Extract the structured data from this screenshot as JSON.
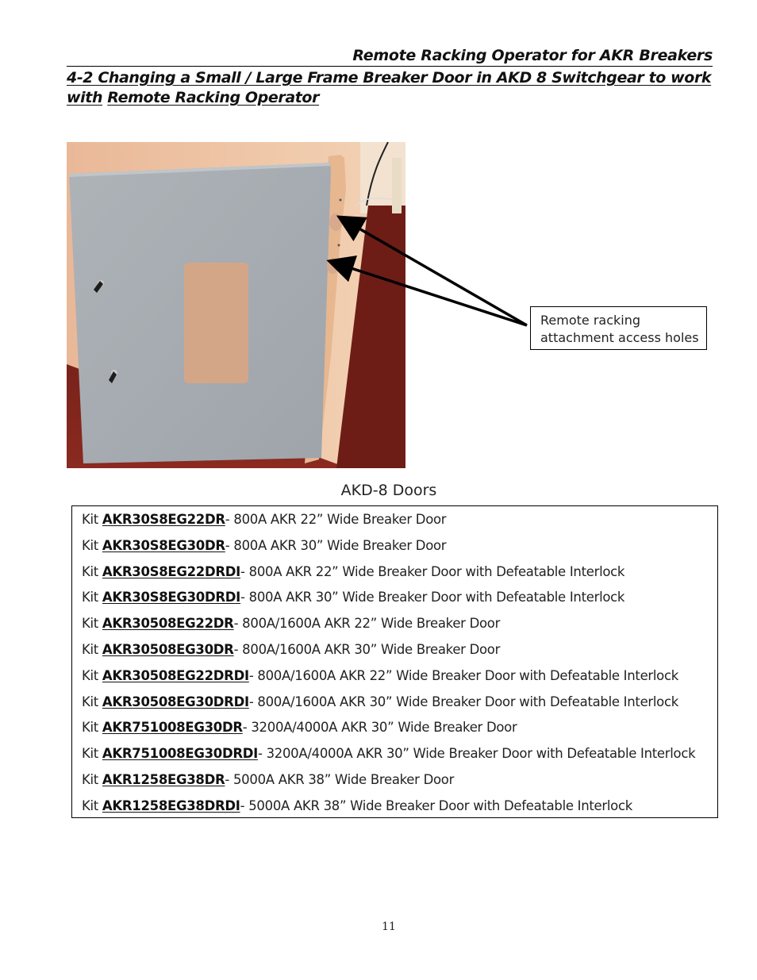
{
  "header": {
    "running_title": "Remote Racking Operator for AKR Breakers"
  },
  "section": {
    "title_line1": "4-2 Changing a Small / Large Frame Breaker Door in AKD 8 Switchgear to work with",
    "title_line2": "Remote Racking Operator"
  },
  "figure": {
    "description": "Photo of grey AKD-8 breaker door with viewing window and two access holes",
    "callout_line1": "Remote racking",
    "callout_line2": "attachment access holes",
    "colors": {
      "door": "#a7acb1",
      "wall": "#f0c9a4",
      "floor": "#7a1f18",
      "window": "#d6a98a"
    }
  },
  "kits": {
    "caption": "AKD-8 Doors",
    "prefix": "Kit ",
    "items": [
      {
        "code": "AKR30S8EG22DR",
        "desc": "- 800A AKR 22” Wide Breaker Door"
      },
      {
        "code": "AKR30S8EG30DR",
        "desc": "- 800A AKR 30” Wide Breaker Door"
      },
      {
        "code": "AKR30S8EG22DRDI",
        "desc": "- 800A AKR 22” Wide Breaker Door with Defeatable Interlock"
      },
      {
        "code": "AKR30S8EG30DRDI",
        "desc": "- 800A AKR 30” Wide Breaker Door with Defeatable Interlock"
      },
      {
        "code": "AKR30508EG22DR",
        "desc": "- 800A/1600A AKR 22” Wide Breaker Door"
      },
      {
        "code": "AKR30508EG30DR",
        "desc": "- 800A/1600A AKR 30” Wide Breaker Door"
      },
      {
        "code": "AKR30508EG22DRDI",
        "desc": "- 800A/1600A AKR 22” Wide Breaker Door with Defeatable Interlock"
      },
      {
        "code": "AKR30508EG30DRDI",
        "desc": "- 800A/1600A AKR 30” Wide Breaker Door with Defeatable Interlock"
      },
      {
        "code": "AKR751008EG30DR",
        "desc": "- 3200A/4000A AKR 30” Wide Breaker Door"
      },
      {
        "code": "AKR751008EG30DRDI",
        "desc": "- 3200A/4000A AKR 30” Wide Breaker Door with Defeatable Interlock"
      },
      {
        "code": "AKR1258EG38DR",
        "desc": "- 5000A AKR 38” Wide Breaker Door"
      },
      {
        "code": "AKR1258EG38DRDI",
        "desc": "- 5000A AKR 38” Wide Breaker Door with Defeatable Interlock"
      }
    ]
  },
  "footer": {
    "page_number": "11"
  }
}
